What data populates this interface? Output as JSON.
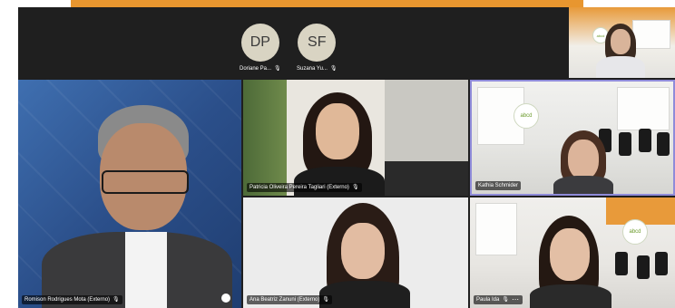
{
  "top_strip": {
    "participants": [
      {
        "initials": "DP",
        "name": "Doriane Pa..."
      },
      {
        "initials": "SF",
        "name": "Suzana Yu..."
      }
    ]
  },
  "tiles": {
    "romison": {
      "name": "Romison Rodrigues Mota (Externo)"
    },
    "patricia": {
      "name": "Patricia Oliveira Pereira Tagliari (Externo)"
    },
    "kathia": {
      "name": "Kathia Schmider"
    },
    "ana": {
      "name": "Ana Beatriz Zanuni (Externo)"
    },
    "paula": {
      "name": "Paula Ida"
    }
  },
  "office_logo": "abcd",
  "colors": {
    "accent_orange": "#e8962f",
    "active_speaker_border": "#8f8bd9",
    "stage_background": "#1f1f1f"
  },
  "icons": {
    "mic": "microphone-icon",
    "more": "more-options-icon",
    "share": "screen-share-icon"
  }
}
